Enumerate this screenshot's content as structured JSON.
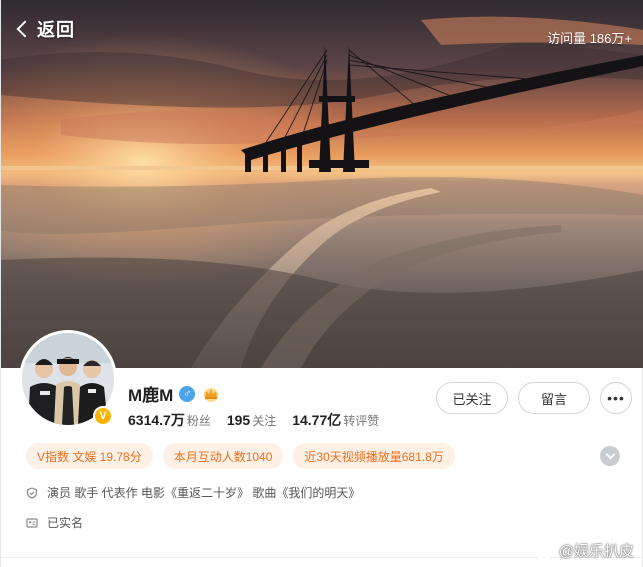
{
  "header": {
    "back_label": "返回",
    "visits": "访问量 186万+"
  },
  "profile": {
    "name": "M鹿M",
    "gender_symbol": "♂",
    "verified_mark": "V",
    "stats": [
      {
        "value": "6314.7万",
        "label": "粉丝"
      },
      {
        "value": "195",
        "label": "关注"
      },
      {
        "value": "14.77亿",
        "label": "转评赞"
      }
    ]
  },
  "actions": {
    "follow_label": "已关注",
    "message_label": "留言",
    "more_label": "•••"
  },
  "chips": [
    "V指数 文娱 19.78分",
    "本月互动人数1040",
    "近30天视频播放量681.8万"
  ],
  "info": {
    "bio": "演员 歌手 代表作 电影《重返二十岁》 歌曲《我们的明天》",
    "real_name": "已实名"
  },
  "watermark": "@娱乐扒皮",
  "colors": {
    "chip_bg": "#fdf0e6",
    "chip_text": "#f06f1e",
    "verified": "#f7b500",
    "gender": "#4aa5e8"
  }
}
